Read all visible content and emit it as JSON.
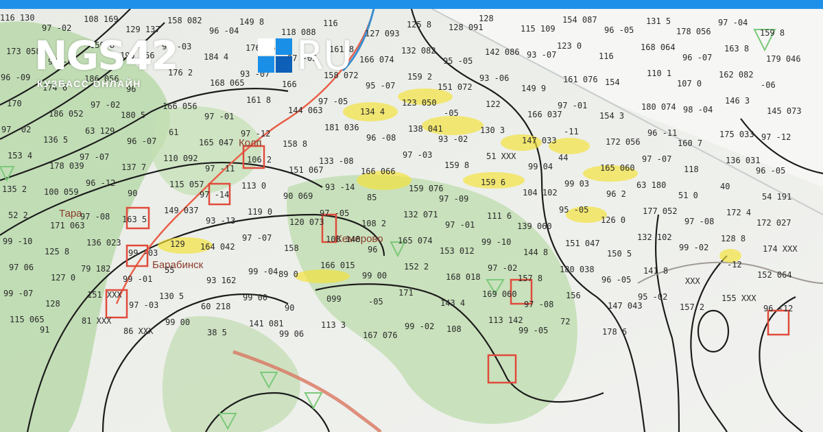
{
  "brand": {
    "name": "NGS42",
    "tld": "RU",
    "tagline": "КУЗБАСС ОНЛАЙН",
    "colors": {
      "top_bar": "#1e90ea",
      "square_light": "#1a8fe8",
      "square_dark": "#0d5fb8"
    }
  },
  "map": {
    "cities": [
      {
        "name": "Барабинск"
      },
      {
        "name": "Кемерово"
      },
      {
        "name": "Тара"
      },
      {
        "name": "Колп"
      }
    ],
    "station_labels": [
      "116 130",
      "97 -02",
      "108 169",
      "129 137",
      "158 082",
      "96 -04",
      "149 8",
      "118 088",
      "116",
      "127 093",
      "125 8",
      "128 091",
      "128",
      "115 109",
      "154 087",
      "96 -05",
      "131 5",
      "178 056",
      "97 -04",
      "159 8",
      "173 058",
      "97 -02",
      "159 8",
      "195 056",
      "98 -03",
      "184 4",
      "176 062",
      "97 -05",
      "161 8",
      "166 074",
      "132 082",
      "95 -05",
      "142 086",
      "93 -07",
      "123 0",
      "116",
      "168 064",
      "96 -07",
      "163 8",
      "179 046",
      "96 -09",
      "174 6",
      "186 056",
      "96",
      "176 2",
      "168 065",
      "93 -07",
      "166",
      "158 072",
      "95 -07",
      "159 2",
      "151 072",
      "93 -06",
      "149 9",
      "161 076",
      "154",
      "110 1",
      "107 0",
      "162 082",
      "-06",
      "170",
      "186 052",
      "97 -02",
      "180 5",
      "166 056",
      "97 -01",
      "161 8",
      "144 063",
      "97 -05",
      "134 4",
      "123 050",
      "-05",
      "122",
      "166 037",
      "97 -01",
      "154 3",
      "180 074",
      "98 -04",
      "146 3",
      "145 073",
      "97 -02",
      "136 5",
      "63 129",
      "96 -07",
      "61",
      "165 047",
      "97 -12",
      "158 8",
      "181 036",
      "96 -08",
      "138 041",
      "93 -02",
      "130 3",
      "147 033",
      "-11",
      "172 056",
      "96 -11",
      "160 7",
      "175 033",
      "97 -12",
      "153 4",
      "178 039",
      "97 -07",
      "137 7",
      "110 092",
      "97 -11",
      "106 2",
      "151 067",
      "133 -08",
      "166 066",
      "97 -03",
      "159 8",
      "51 XXX",
      "99 04",
      "44",
      "165 060",
      "97 -07",
      "118",
      "136 031",
      "96 -05",
      "135 2",
      "100 059",
      "96 -12",
      "90",
      "115 057",
      "97 -14",
      "113 0",
      "90 069",
      "93 -14",
      "85",
      "159 076",
      "97 -09",
      "159 6",
      "104 102",
      "99 03",
      "96 2",
      "63 180",
      "51 0",
      "40",
      "54 191",
      "52 2",
      "171 063",
      "97 -08",
      "163 5",
      "149 037",
      "93 -13",
      "119 0",
      "120 073",
      "97 -05",
      "108 2",
      "132 071",
      "97 -01",
      "111 6",
      "139 060",
      "95 -05",
      "126 0",
      "177 052",
      "97 -08",
      "172 4",
      "172 027",
      "99 -10",
      "125 8",
      "136 023",
      "99 -03",
      "129",
      "164 042",
      "97 -07",
      "158",
      "108 148",
      "96",
      "165 074",
      "153 012",
      "99 -10",
      "144 8",
      "151 047",
      "150 5",
      "132 102",
      "99 -02",
      "128 8",
      "174 XXX",
      "97 06",
      "127 0",
      "79 182",
      "99 -01",
      "55",
      "93 162",
      "99 -04",
      "89 0",
      "166 015",
      "99 00",
      "152 2",
      "168 018",
      "97 -02",
      "157 8",
      "180 038",
      "96 -05",
      "141 8",
      "XXX",
      "-12",
      "152 064",
      "99 -07",
      "128",
      "151 XXX",
      "97 -03",
      "130 5",
      "60 218",
      "99 00",
      "90",
      "099",
      "-05",
      "171",
      "143 4",
      "169 060",
      "97 -08",
      "156",
      "147 043",
      "95 -02",
      "157 2",
      "155 XXX",
      "96 -12",
      "115 065",
      "91",
      "81 XXX",
      "86 XXX",
      "99 00",
      "38 5",
      "141 081",
      "99 06",
      "113 3",
      "167 076",
      "99 -02",
      "108",
      "113 142",
      "99 -05",
      "72",
      "178 6"
    ]
  }
}
